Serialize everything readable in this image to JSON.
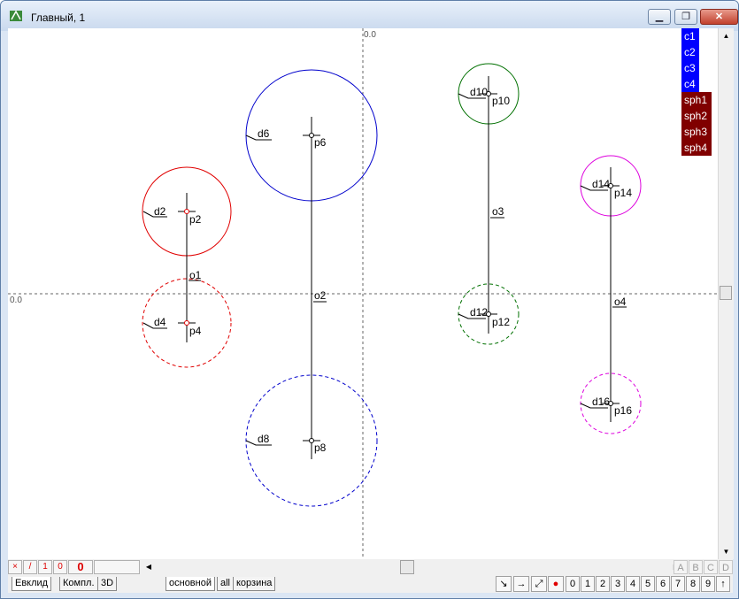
{
  "window": {
    "title": "Главный, 1",
    "min_label": "▁",
    "max_label": "❐",
    "close_label": "✕"
  },
  "axes": {
    "x_origin_label": "0.0",
    "y_origin_label": "0.0"
  },
  "legend": {
    "curves": [
      "c1",
      "c2",
      "c3",
      "c4"
    ],
    "spheres": [
      "sph1",
      "sph2",
      "sph3",
      "sph4"
    ],
    "curve_color": "#0000ff",
    "sphere_color": "#800000"
  },
  "scene": {
    "axes_labels": [
      "o1",
      "o2",
      "o3",
      "o4"
    ],
    "points": [
      "p2",
      "p4",
      "p6",
      "p8",
      "p10",
      "p12",
      "p14",
      "p16"
    ],
    "diameters": [
      "d2",
      "d4",
      "d6",
      "d8",
      "d10",
      "d12",
      "d14",
      "d16"
    ],
    "colors": {
      "red": "#e00000",
      "blue": "#0000cc",
      "green": "#007000",
      "magenta": "#dd00dd"
    }
  },
  "status": {
    "btn_x": "×",
    "btn_slash": "/",
    "btn_1": "1",
    "btn_0": "0",
    "counter": "0"
  },
  "abcd": [
    "A",
    "B",
    "C",
    "D"
  ],
  "tabs_left": [
    "Евклид",
    "Компл.",
    "3D"
  ],
  "tabs_layers": [
    "основной",
    "all",
    "корзина"
  ],
  "tools": [
    "↘",
    "→",
    "⤢",
    "●"
  ],
  "numbers": [
    "0",
    "1",
    "2",
    "3",
    "4",
    "5",
    "6",
    "7",
    "8",
    "9",
    "↑"
  ]
}
